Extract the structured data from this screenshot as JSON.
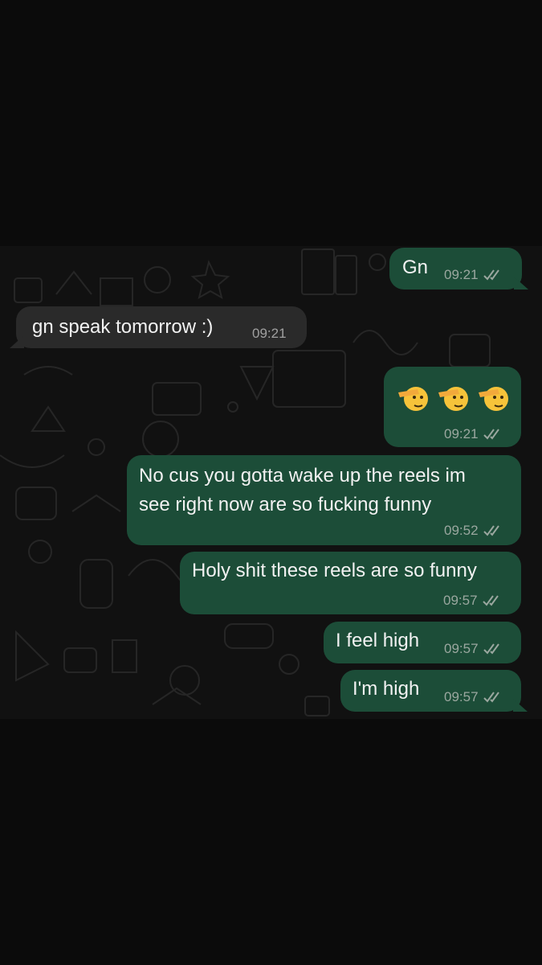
{
  "messages": [
    {
      "text": "Gn",
      "time": "09:21",
      "direction": "outgoing",
      "status": "read"
    },
    {
      "text": "gn speak tomorrow :)",
      "time": "09:21",
      "direction": "incoming"
    },
    {
      "text": "🫡🫡🫡",
      "time": "09:21",
      "direction": "outgoing",
      "status": "read",
      "emoji_icon": "saluting-face-emoji"
    },
    {
      "lines": [
        "No cus you gotta wake up the reels im",
        "see right now are so fucking funny"
      ],
      "time": "09:52",
      "direction": "outgoing",
      "status": "read"
    },
    {
      "text": "Holy shit these reels are so funny",
      "time": "09:57",
      "direction": "outgoing",
      "status": "read"
    },
    {
      "text": "I feel high",
      "time": "09:57",
      "direction": "outgoing",
      "status": "read"
    },
    {
      "text": "I'm high",
      "time": "09:57",
      "direction": "outgoing",
      "status": "read"
    }
  ],
  "colors": {
    "outgoing_bubble": "#1c4d38",
    "incoming_bubble": "#2a2a2a",
    "chat_background": "#111111",
    "page_background": "#0b0b0b",
    "read_ticks": "#9aa79f"
  }
}
